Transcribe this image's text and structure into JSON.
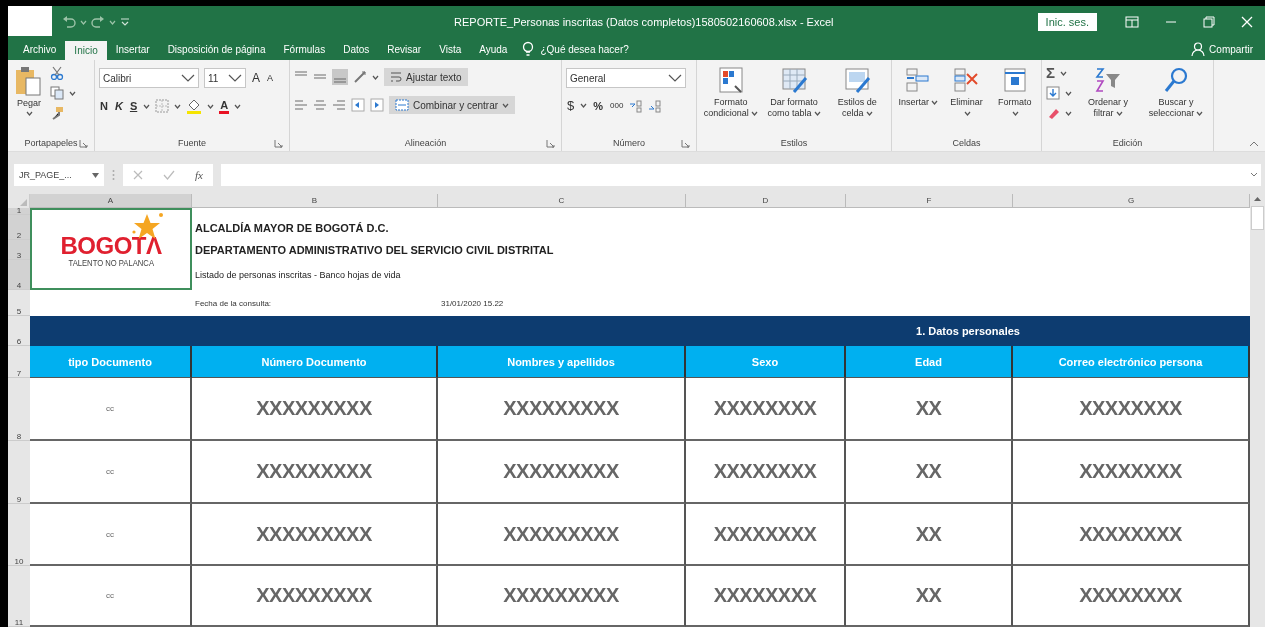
{
  "window": {
    "title": "REPORTE_Personas inscritas (Datos completos)1580502160608.xlsx  -  Excel",
    "sign_in": "Inic. ses."
  },
  "tabs": [
    {
      "label": "Archivo",
      "selected": false
    },
    {
      "label": "Inicio",
      "selected": true
    },
    {
      "label": "Insertar",
      "selected": false
    },
    {
      "label": "Disposición de página",
      "selected": false
    },
    {
      "label": "Fórmulas",
      "selected": false
    },
    {
      "label": "Datos",
      "selected": false
    },
    {
      "label": "Revisar",
      "selected": false
    },
    {
      "label": "Vista",
      "selected": false
    },
    {
      "label": "Ayuda",
      "selected": false
    }
  ],
  "tell_me": "¿Qué desea hacer?",
  "share": "Compartir",
  "ribbon": [
    {
      "kind": "clipboard",
      "label": "Portapapeles",
      "launcher": true,
      "paste": "Pegar"
    },
    {
      "kind": "font",
      "label": "Fuente",
      "launcher": true,
      "font": "Calibri",
      "size": "11",
      "size_buttons": [
        "A",
        "A"
      ],
      "style_buttons": [
        "N",
        "K",
        "S"
      ],
      "color_button": "A"
    },
    {
      "kind": "alignment",
      "label": "Alineación",
      "launcher": true,
      "wrap": "Ajustar texto",
      "merge": "Combinar y centrar"
    },
    {
      "kind": "number",
      "label": "Número",
      "launcher": true,
      "format": "General",
      "symbols": [
        "$",
        "%",
        "000"
      ]
    },
    {
      "kind": "buttons",
      "label": "Estilos",
      "launcher": false,
      "items": [
        {
          "label": "Formato condicional",
          "menu": true
        },
        {
          "label": "Dar formato como tabla",
          "menu": true
        },
        {
          "label": "Estilos de celda",
          "menu": true
        }
      ]
    },
    {
      "kind": "buttons",
      "label": "Celdas",
      "launcher": false,
      "items": [
        {
          "label": "Insertar",
          "menu": true
        },
        {
          "label": "Eliminar",
          "menu": true
        },
        {
          "label": "Formato",
          "menu": true
        }
      ]
    },
    {
      "kind": "editing",
      "label": "Edición",
      "launcher": false,
      "autosum": "Σ",
      "items": [
        {
          "label": "Ordenar y filtrar",
          "menu": true
        },
        {
          "label": "Buscar y seleccionar",
          "menu": true
        }
      ]
    }
  ],
  "formula_bar": {
    "name_box": "JR_PAGE_...",
    "function_label": "fx"
  },
  "sheet": {
    "columns": [
      "A",
      "B",
      "C",
      "D",
      "F",
      "G"
    ],
    "row_numbers": [
      "1",
      "2",
      "3",
      "4",
      "5",
      "6",
      "7",
      "8",
      "9",
      "10",
      "11"
    ],
    "logo": {
      "name": "BOGOTΛ",
      "tagline": "TALENTO NO PALANCA"
    },
    "heading_lines": [
      "ALCALDÍA MAYOR DE BOGOTÁ D.C.",
      "DEPARTAMENTO ADMINISTRATIVO DEL SERVICIO CIVIL DISTRITAL",
      "Listado de personas inscritas - Banco hojas de vida"
    ],
    "query_label": "Fecha de la consulta:",
    "query_date": "31/01/2020 15.22",
    "section": "1. Datos personales",
    "headers": [
      "tipo Documento",
      "Número Documento",
      "Nombres y apellidos",
      "Sexo",
      "Edad",
      "Correo electrónico persona"
    ],
    "rows": [
      [
        "cc",
        "XXXXXXXXX",
        "XXXXXXXXX",
        "XXXXXXXX",
        "XX",
        "XXXXXXXX"
      ],
      [
        "cc",
        "XXXXXXXXX",
        "XXXXXXXXX",
        "XXXXXXXX",
        "XX",
        "XXXXXXXX"
      ],
      [
        "cc",
        "XXXXXXXXX",
        "XXXXXXXXX",
        "XXXXXXXX",
        "XX",
        "XXXXXXXX"
      ],
      [
        "cc",
        "XXXXXXXXX",
        "XXXXXXXXX",
        "XXXXXXXX",
        "XX",
        "XXXXXXXX"
      ]
    ]
  }
}
